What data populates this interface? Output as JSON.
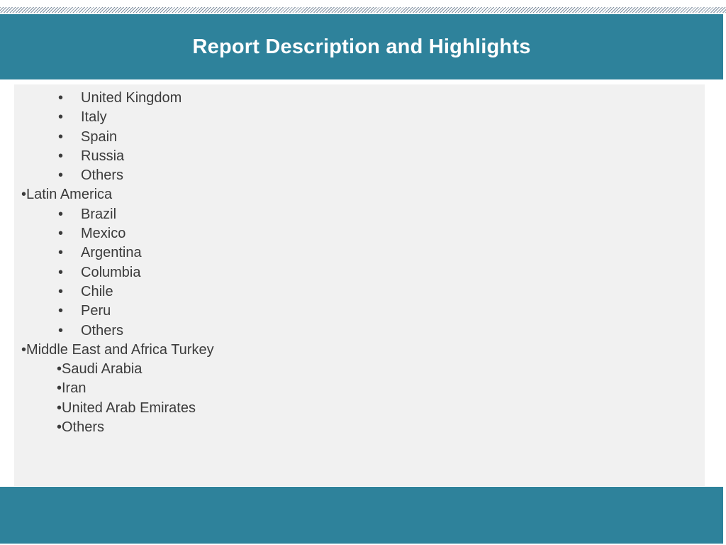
{
  "slide": {
    "title": "Report Description and Highlights"
  },
  "list": [
    {
      "level": 2,
      "text": "United Kingdom"
    },
    {
      "level": 2,
      "text": "Italy"
    },
    {
      "level": 2,
      "text": "Spain"
    },
    {
      "level": 2,
      "text": "Russia"
    },
    {
      "level": 2,
      "text": "Others"
    },
    {
      "level": 1,
      "text": "•Latin America"
    },
    {
      "level": 2,
      "text": "Brazil"
    },
    {
      "level": 2,
      "text": "Mexico"
    },
    {
      "level": 2,
      "text": "Argentina"
    },
    {
      "level": 2,
      "text": "Columbia"
    },
    {
      "level": 2,
      "text": "Chile"
    },
    {
      "level": 2,
      "text": "Peru"
    },
    {
      "level": 2,
      "text": "Others"
    },
    {
      "level": 1,
      "text": "•Middle East and Africa Turkey"
    },
    {
      "level": 3,
      "text": "•Saudi Arabia"
    },
    {
      "level": 3,
      "text": "•Iran"
    },
    {
      "level": 3,
      "text": "•United Arab Emirates"
    },
    {
      "level": 3,
      "text": "•Others"
    }
  ],
  "bullet_char": "•",
  "colors": {
    "band": "#2e829b",
    "panel": "#f1f1f1",
    "text": "#3b3b3b",
    "title_text": "#ffffff"
  }
}
